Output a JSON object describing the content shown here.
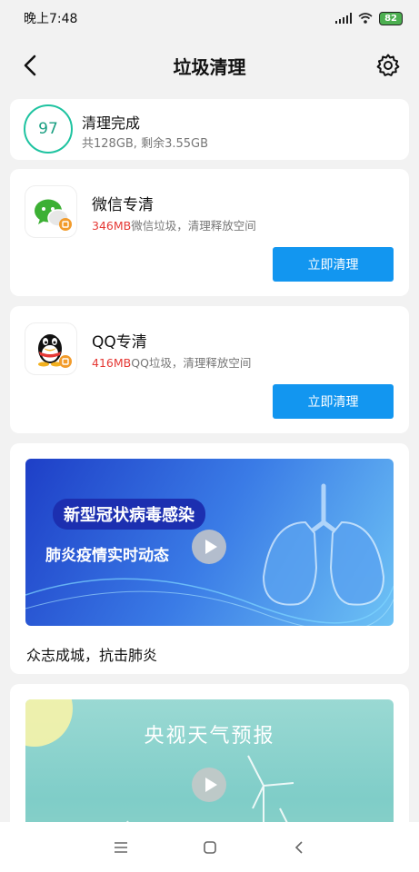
{
  "status_bar": {
    "time": "晚上7:48",
    "battery": "82"
  },
  "header": {
    "title": "垃圾清理"
  },
  "score": {
    "value": "97",
    "title": "清理完成",
    "subtitle": "共128GB, 剩余3.55GB"
  },
  "wechat": {
    "title": "微信专清",
    "size": "346MB",
    "desc": "微信垃圾，清理释放空间",
    "button": "立即清理"
  },
  "qq": {
    "title": "QQ专清",
    "size": "416MB",
    "desc": "QQ垃圾，清理释放空间",
    "button": "立即清理"
  },
  "news": {
    "tag1": "新型冠状病毒感染",
    "tag2": "肺炎疫情实时动态",
    "caption": "众志成城，抗击肺炎"
  },
  "weather": {
    "title": "央视天气预报"
  },
  "colors": {
    "accent": "#1296f0",
    "score_ring": "#1ec3a0",
    "size_text": "#e53935"
  }
}
